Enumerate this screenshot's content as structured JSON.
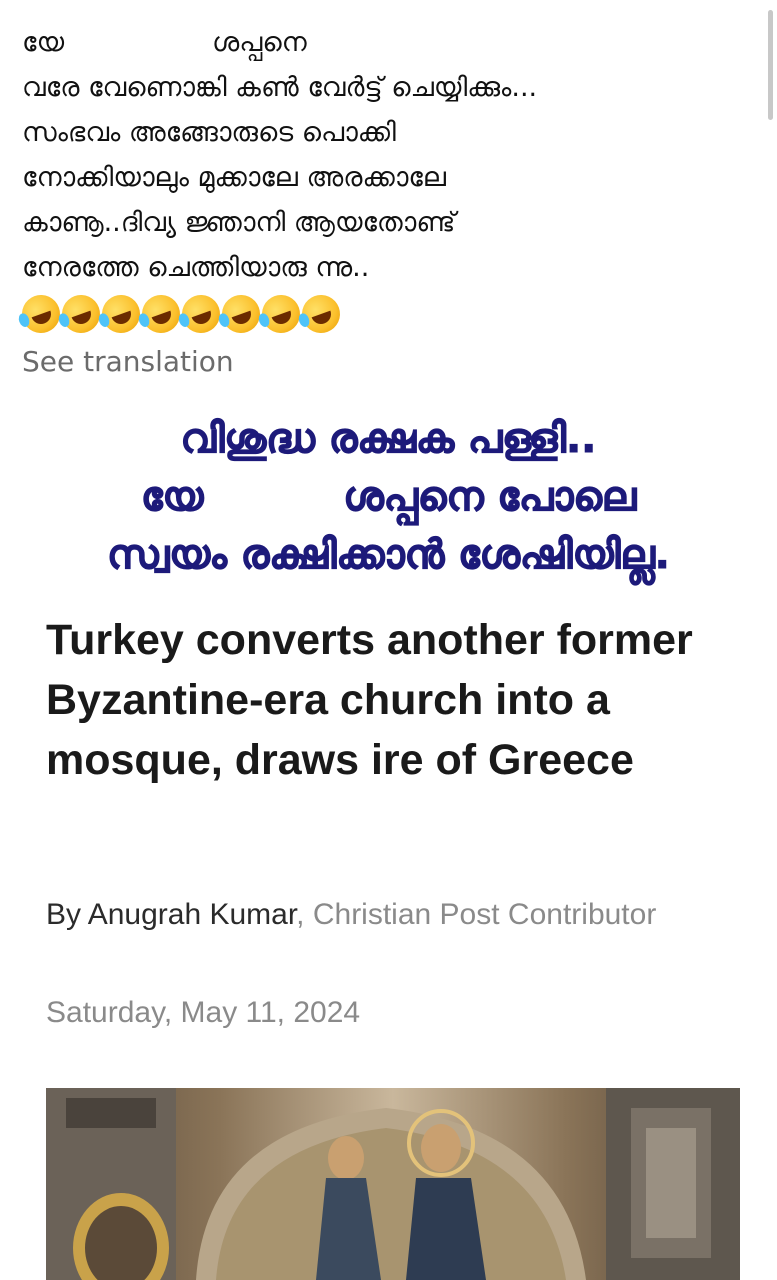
{
  "post": {
    "lines": [
      [
        "യേ",
        "ശപ്പനെ"
      ],
      "വരേ വേണൊങ്കി കൺ വേർട്ട് ചെയ്യിക്കും...",
      "സംഭവം അങ്ങോരുടെ പൊക്കി",
      "നോക്കിയാലും മുക്കാലേ അരക്കാലേ",
      "കാണൂ..ദിവ്യ ജ്ഞാനി ആയതോണ്ട്",
      "നേരത്തേ ചെത്തിയാരു ന്നു.."
    ],
    "emoji_count": 8,
    "emoji_name": "rolling-on-floor-laughing-emoji",
    "see_translation": "See translation"
  },
  "image": {
    "overlay_lines": [
      "വിശുദ്ധ രക്ഷക പള്ളി..",
      [
        "യേ",
        "ശപ്പനെ പോലെ"
      ],
      "സ്വയം രക്ഷിക്കാൻ ശേഷിയില്ല."
    ],
    "headline": "Turkey converts another former Byzantine-era church into a mosque, draws ire of Greece",
    "byline_prefix": "By ",
    "author": "Anugrah Kumar",
    "byline_suffix": ", Christian Post Contributor",
    "date": "Saturday, May 11, 2024",
    "photo_subject": "byzantine-mosaic-christ-and-virgin-mary"
  },
  "colors": {
    "overlay_text": "#1d1a7a",
    "secondary_text": "#8a8a8a",
    "translation_link": "#6b6b6b"
  }
}
